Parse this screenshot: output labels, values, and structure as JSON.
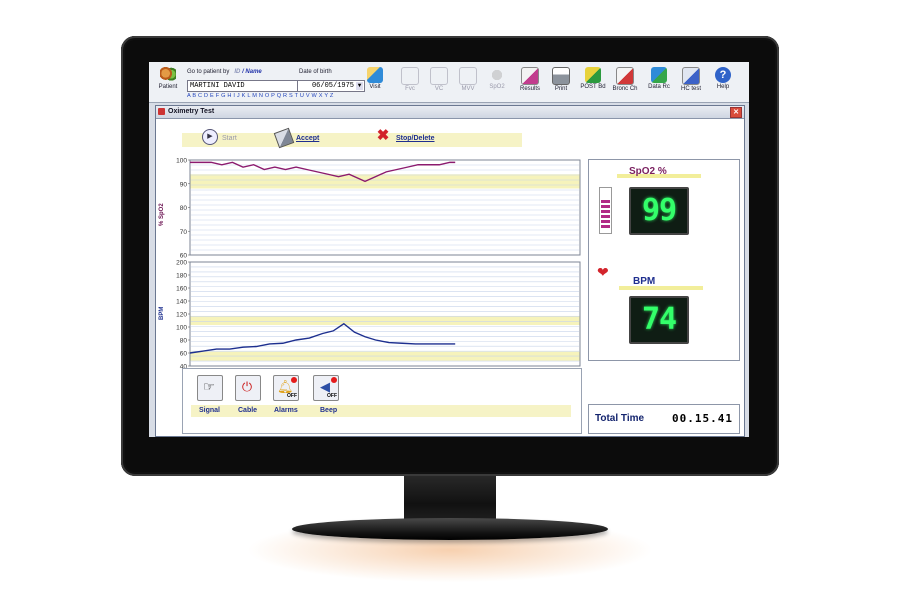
{
  "toolbar": {
    "patient_label": "Patient",
    "goto_label": "Go to patient by",
    "id_label": "ID",
    "name_label": "/ Name",
    "dob_label": "Date of birth",
    "patient_name": "MARTINI DAVID",
    "dob_value": "06/05/1975",
    "alphabet": "A B C D E F G H I J K L M N O P Q R S T U V W X Y Z",
    "visit_label": "Visit",
    "fvc_label": "Fvc",
    "vc_label": "VC",
    "mvv_label": "MVV",
    "spo2_label": "SpO2",
    "results_label": "Results",
    "print_label": "Print",
    "postbd_label": "POST Bd",
    "bronch_label": "Bronc Ch",
    "datarc_label": "Data Rc",
    "hctest_label": "HC test",
    "help_label": "Help"
  },
  "window": {
    "title": "Oximetry Test",
    "start_label": "Start",
    "accept_label": "Accept",
    "stop_label": "Stop/Delete"
  },
  "chart_data": [
    {
      "type": "line",
      "ylabel": "% SpO2",
      "ylim": [
        60,
        100
      ],
      "yticks": [
        "100",
        "90",
        "80",
        "70",
        "60"
      ],
      "x": [
        0,
        4,
        8,
        12,
        16,
        20,
        24,
        28,
        32,
        36,
        40,
        44,
        48,
        52,
        56,
        60,
        64,
        66,
        70,
        74,
        78,
        82,
        86,
        90,
        94,
        98,
        100
      ],
      "series": [
        {
          "values": [
            99,
            99,
            99,
            98,
            99,
            97,
            98,
            96,
            97,
            96,
            97,
            96,
            95,
            94,
            93,
            94,
            92,
            91,
            93,
            95,
            96,
            97,
            98,
            98,
            98,
            99,
            99
          ]
        }
      ],
      "bands": [
        [
          88,
          94
        ]
      ],
      "color": "#8b1a6e"
    },
    {
      "type": "line",
      "ylabel": "BPM",
      "ylim": [
        40,
        200
      ],
      "yticks": [
        "200",
        "180",
        "160",
        "140",
        "120",
        "100",
        "80",
        "60",
        "40"
      ],
      "x": [
        0,
        5,
        10,
        15,
        20,
        25,
        30,
        35,
        40,
        45,
        50,
        54,
        58,
        62,
        66,
        70,
        75,
        80,
        85,
        90,
        95,
        100
      ],
      "series": [
        {
          "values": [
            60,
            63,
            66,
            66,
            69,
            70,
            74,
            75,
            80,
            83,
            90,
            94,
            105,
            92,
            85,
            80,
            76,
            75,
            74,
            74,
            74,
            74
          ]
        }
      ],
      "bands": [
        [
          103,
          117
        ],
        [
          48,
          62
        ]
      ],
      "color": "#1d2f8f"
    }
  ],
  "readouts": {
    "spo2_title": "SpO2  %",
    "spo2_value": "99",
    "bpm_title": "BPM",
    "bpm_value": "74",
    "total_label": "Total Time",
    "total_value": "00.15.41"
  },
  "controls": {
    "signal_label": "Signal",
    "cable_label": "Cable",
    "alarms_label": "Alarms",
    "beep_label": "Beep",
    "off_text": "OFF"
  }
}
